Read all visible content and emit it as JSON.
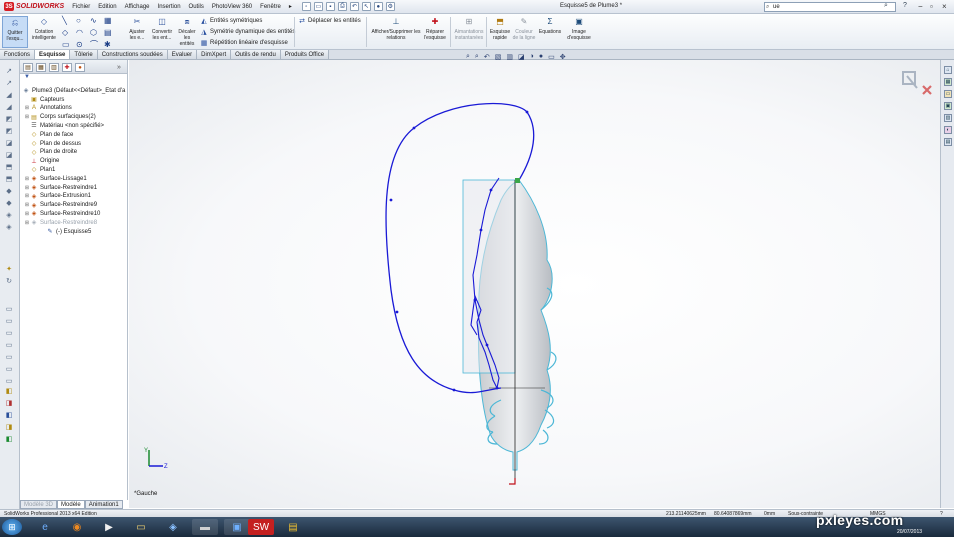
{
  "app": {
    "brand": "SOLIDWORKS",
    "doc_title": "Esquisse5 de Plume3 *",
    "menus": [
      "Fichier",
      "Edition",
      "Affichage",
      "Insertion",
      "Outils",
      "PhotoView 360",
      "Fenêtre"
    ],
    "menu_more": "▸",
    "search_value": "ue",
    "help_label": "?",
    "window_controls": [
      "−",
      "▫",
      "×"
    ]
  },
  "commands": {
    "exit_sketch": "Quitter l'esqu...",
    "smart_dim": "Cotation intelligente",
    "trim": "Ajuster les e...",
    "convert": "Convertir les ent...",
    "offset": "Décaler les entités",
    "mirror": "Entités symétriques",
    "dyn_mirror": "Symétrie dynamique des entités",
    "linear_pattern": "Répétition linéaire d'esquisse",
    "move": "Déplacer les entités",
    "show_relations": "Afficher/Supprimer les relations",
    "repair": "Réparer l'esquisse",
    "snaps": "Aimantations instantanées",
    "rapid_sketch": "Esquisse rapide",
    "line_color": "Couleur de la ligne",
    "equations": "Equations",
    "sketch_picture": "Image d'esquisse"
  },
  "tabs": [
    "Fonctions",
    "Esquisse",
    "Tôlerie",
    "Constructions soudées",
    "Evaluer",
    "DimXpert",
    "Outils de rendu",
    "Produits Office"
  ],
  "active_tab": "Esquisse",
  "tree": {
    "filter_icon": "▼",
    "collapse_label": "»",
    "root": "Plume3 (Défaut<<Défaut>_Etat d'a",
    "items": [
      {
        "label": "Capteurs",
        "icon": "sensor-icon",
        "expandable": false
      },
      {
        "label": "Annotations",
        "icon": "annotation-icon",
        "expandable": true
      },
      {
        "label": "Corps surfaciques(2)",
        "icon": "surface-bodies-icon",
        "expandable": true
      },
      {
        "label": "Matériau <non spécifié>",
        "icon": "material-icon",
        "expandable": false
      },
      {
        "label": "Plan de face",
        "icon": "plane-icon",
        "expandable": false
      },
      {
        "label": "Plan de dessus",
        "icon": "plane-icon",
        "expandable": false
      },
      {
        "label": "Plan de droite",
        "icon": "plane-icon",
        "expandable": false
      },
      {
        "label": "Origine",
        "icon": "origin-icon",
        "expandable": false
      },
      {
        "label": "Plan1",
        "icon": "plane-icon",
        "expandable": false
      },
      {
        "label": "Surface-Lissage1",
        "icon": "loft-surface-icon",
        "expandable": true
      },
      {
        "label": "Surface-Restreindre1",
        "icon": "trim-surface-icon",
        "expandable": true
      },
      {
        "label": "Surface-Extrusion1",
        "icon": "extrude-surface-icon",
        "expandable": true
      },
      {
        "label": "Surface-Restreindre9",
        "icon": "trim-surface-icon",
        "expandable": true
      },
      {
        "label": "Surface-Restreindre10",
        "icon": "trim-surface-icon",
        "expandable": true
      },
      {
        "label": "Surface-Restreindre8",
        "icon": "trim-surface-icon",
        "expandable": true,
        "greyed": true
      },
      {
        "label": "(-) Esquisse5",
        "icon": "sketch-icon",
        "expandable": false,
        "child": true
      }
    ]
  },
  "model_tabs": [
    "Modèle",
    "Animation1"
  ],
  "model_tab_disabled": "Modèle 3D",
  "view_label": "*Gauche",
  "triad": {
    "y": "Y",
    "z": "Z"
  },
  "status": {
    "product": "SolidWorks Professional 2013 x64 Edition",
    "coords": "213.21140625mm",
    "coords2": "80.64087869mm",
    "z": "0mm",
    "state": "Sous-contrainte",
    "units": "MMGS",
    "help": "?"
  },
  "watermark": "pxleyes.com",
  "watermark_date": "20/07/2013",
  "colors": {
    "sketch_blue": "#1a1ad6",
    "surface_cyan": "#4cb7d6",
    "accent_red": "#c0101a"
  }
}
